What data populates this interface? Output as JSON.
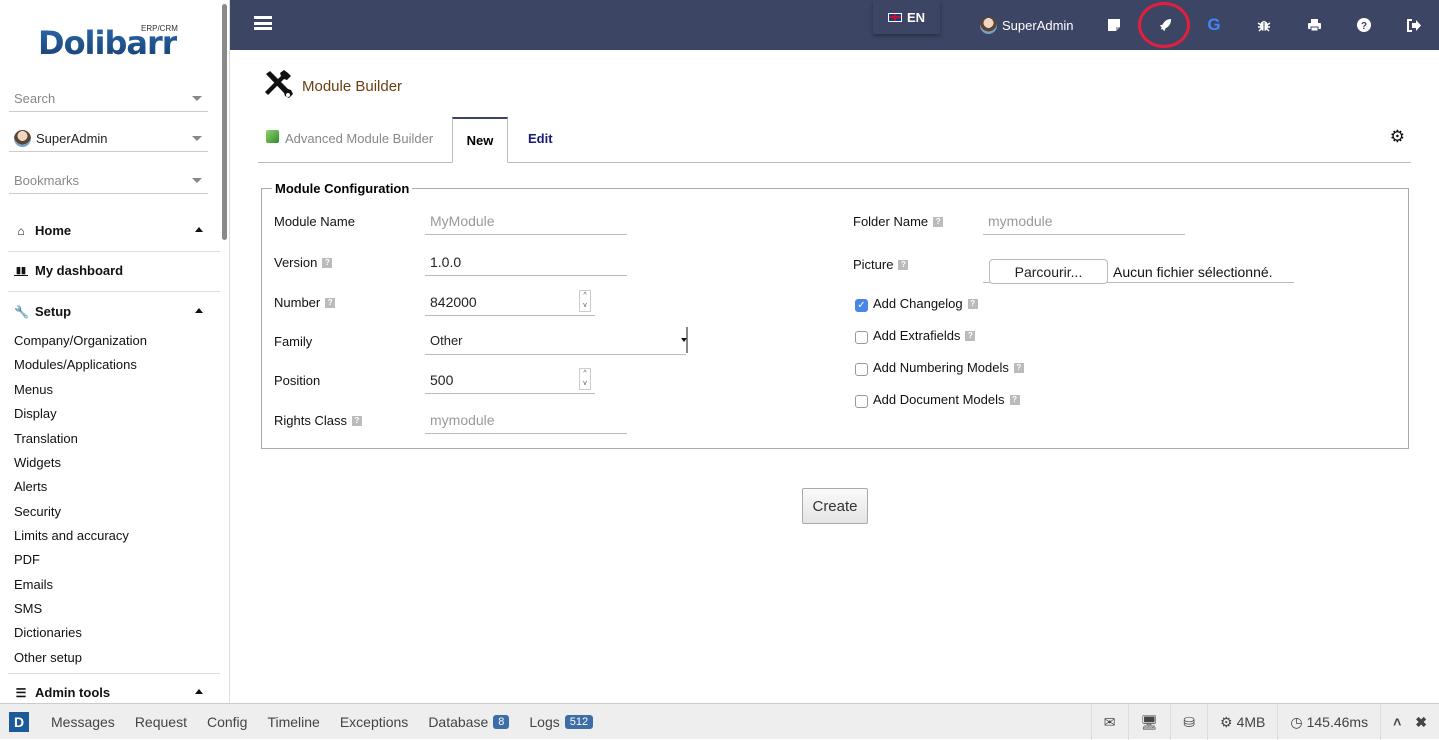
{
  "sidebar": {
    "logo": {
      "main": "Dolibarr",
      "sub": "ERP/CRM"
    },
    "search_placeholder": "Search",
    "user_select": "SuperAdmin",
    "bookmarks_placeholder": "Bookmarks",
    "home": "Home",
    "dashboard": "My dashboard",
    "setup": "Setup",
    "setup_items": [
      "Company/Organization",
      "Modules/Applications",
      "Menus",
      "Display",
      "Translation",
      "Widgets",
      "Alerts",
      "Security",
      "Limits and accuracy",
      "PDF",
      "Emails",
      "SMS",
      "Dictionaries",
      "Other setup"
    ],
    "admin_tools": "Admin tools"
  },
  "topbar": {
    "language": "EN",
    "user": "SuperAdmin",
    "icons": [
      "note-icon",
      "rocket-icon",
      "google-icon",
      "bug-icon",
      "print-icon",
      "help-icon",
      "logout-icon"
    ],
    "highlight_color": "#e41e3f"
  },
  "page": {
    "title": "Module Builder",
    "tabs": {
      "advanced": "Advanced Module Builder",
      "new": "New",
      "edit": "Edit"
    },
    "legend": "Module Configuration",
    "fields": {
      "module_name": {
        "label": "Module Name",
        "placeholder": "MyModule"
      },
      "version": {
        "label": "Version",
        "value": "1.0.0"
      },
      "number": {
        "label": "Number",
        "value": "842000"
      },
      "family": {
        "label": "Family",
        "value": "Other"
      },
      "position": {
        "label": "Position",
        "value": "500"
      },
      "rights_class": {
        "label": "Rights Class",
        "placeholder": "mymodule"
      },
      "folder_name": {
        "label": "Folder Name",
        "placeholder": "mymodule"
      },
      "picture": {
        "label": "Picture",
        "button": "Parcourir...",
        "status": "Aucun fichier sélectionné."
      }
    },
    "checkboxes": [
      {
        "label": "Add Changelog",
        "checked": true
      },
      {
        "label": "Add Extrafields",
        "checked": false
      },
      {
        "label": "Add Numbering Models",
        "checked": false
      },
      {
        "label": "Add Document Models",
        "checked": false
      }
    ],
    "create_button": "Create"
  },
  "debugbar": {
    "logo": "D",
    "tabs": [
      "Messages",
      "Request",
      "Config",
      "Timeline",
      "Exceptions",
      "Database",
      "Logs"
    ],
    "database_count": "8",
    "logs_count": "512",
    "memory": "4MB",
    "time": "145.46ms"
  }
}
